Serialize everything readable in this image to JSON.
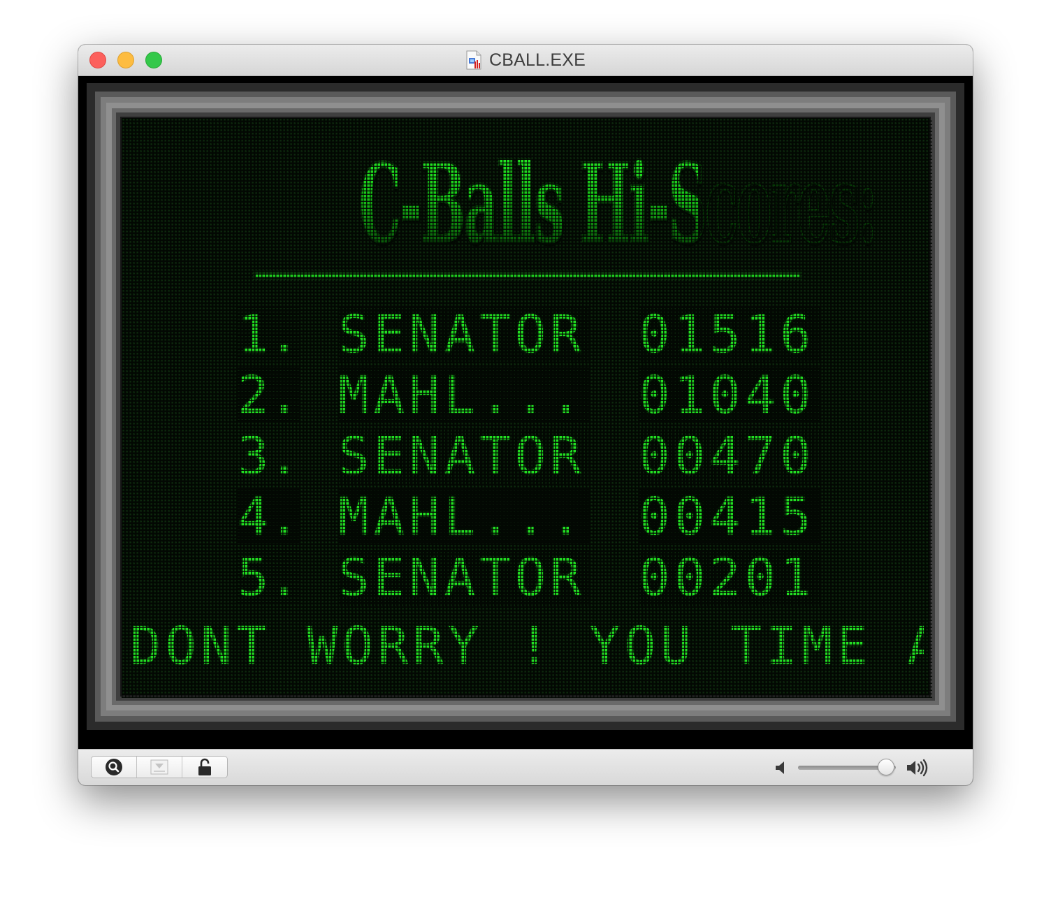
{
  "window": {
    "title": "CBALL.EXE",
    "icon": "document-app-icon"
  },
  "game": {
    "heading": "C-Balls Hi-Scores:",
    "scores": [
      {
        "rank": "1.",
        "name": "SENATOR",
        "score": "01516"
      },
      {
        "rank": "2.",
        "name": "MAHL...",
        "score": "01040"
      },
      {
        "rank": "3.",
        "name": "SENATOR",
        "score": "00470"
      },
      {
        "rank": "4.",
        "name": "MAHL...",
        "score": "00415"
      },
      {
        "rank": "5.",
        "name": "SENATOR",
        "score": "00201"
      }
    ],
    "ticker": "DONT WORRY ! YOU TIME AT",
    "colors": {
      "lcd_green": "#22e022",
      "lcd_background": "#030803",
      "frame_gray": "#8f8f8f"
    }
  },
  "toolbar": {
    "buttons": [
      {
        "icon": "magnifier-icon"
      },
      {
        "icon": "dropdown-tray-icon"
      },
      {
        "icon": "unlock-icon"
      }
    ],
    "volume": {
      "level": 0.9,
      "low_icon": "speaker-low-icon",
      "high_icon": "speaker-high-icon"
    }
  }
}
